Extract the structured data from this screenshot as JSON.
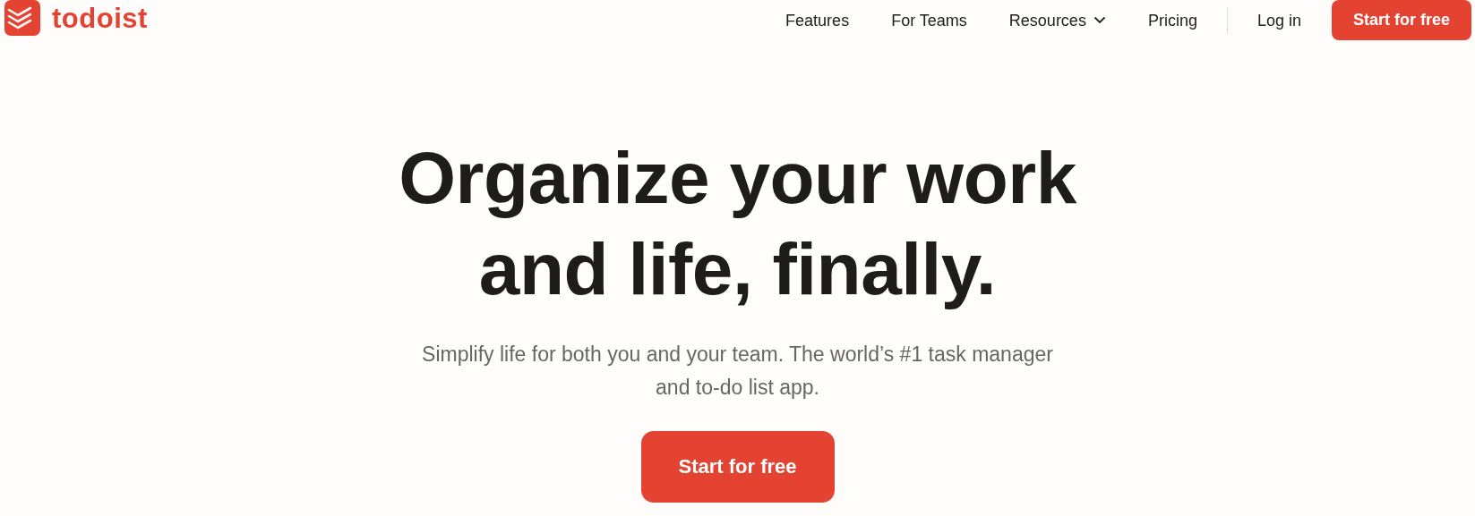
{
  "header": {
    "logo_text": "todoist",
    "nav": [
      {
        "label": "Features",
        "kind": "link"
      },
      {
        "label": "For Teams",
        "kind": "link"
      },
      {
        "label": "Resources",
        "kind": "dropdown"
      },
      {
        "label": "Pricing",
        "kind": "link"
      }
    ],
    "login": "Log in",
    "cta": "Start for free"
  },
  "hero": {
    "headline_lines": [
      "Organize your work",
      "and life, finally."
    ],
    "subtitle": "Simplify life for both you and your team. The world’s #1 task manager and to-do list app.",
    "cta": "Start for free"
  }
}
